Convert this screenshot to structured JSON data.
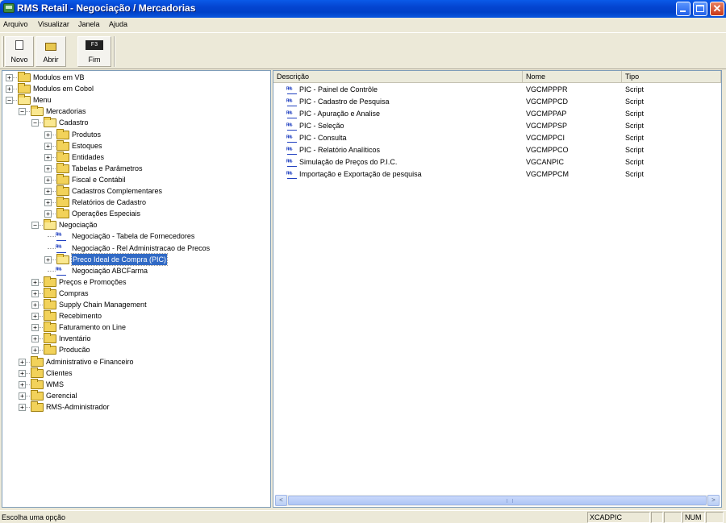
{
  "window": {
    "title": "RMS Retail - Negociação / Mercadorias",
    "minimize_icon": "minimize-icon",
    "maximize_icon": "maximize-icon",
    "close_symbol": "✕"
  },
  "menubar": {
    "items": [
      "Arquivo",
      "Visualizar",
      "Janela",
      "Ajuda"
    ]
  },
  "toolbar": {
    "new_label": "Novo",
    "open_label": "Abrir",
    "exit_label": "Fim",
    "exit_key": "F3"
  },
  "tree": {
    "nodes": [
      {
        "label": "Modulos em VB",
        "expander": "+"
      },
      {
        "label": "Modulos em Cobol",
        "expander": "+"
      },
      {
        "label": "Menu",
        "expander": "−"
      },
      {
        "label": "Mercadorias",
        "expander": "−"
      },
      {
        "label": "Cadastro",
        "expander": "−"
      },
      {
        "label": "Produtos",
        "expander": "+"
      },
      {
        "label": "Estoques",
        "expander": "+"
      },
      {
        "label": "Entidades",
        "expander": "+"
      },
      {
        "label": "Tabelas e Parâmetros",
        "expander": "+"
      },
      {
        "label": "Fiscal e Contábil",
        "expander": "+"
      },
      {
        "label": "Cadastros Complementares",
        "expander": "+"
      },
      {
        "label": "Relatórios de Cadastro",
        "expander": "+"
      },
      {
        "label": "Operações Especiais",
        "expander": "+"
      },
      {
        "label": "Negociação",
        "expander": "−"
      },
      {
        "label": "Negociação - Tabela de Fornecedores",
        "expander": ""
      },
      {
        "label": "Negociação - Rel Administracao de Precos",
        "expander": ""
      },
      {
        "label": "Preco Ideal de Compra (PIC)",
        "expander": "+"
      },
      {
        "label": "Negociação  ABCFarma",
        "expander": ""
      },
      {
        "label": "Preços e Promoções",
        "expander": "+"
      },
      {
        "label": "Compras",
        "expander": "+"
      },
      {
        "label": "Supply Chain Management",
        "expander": "+"
      },
      {
        "label": "Recebimento",
        "expander": "+"
      },
      {
        "label": "Faturamento on Line",
        "expander": "+"
      },
      {
        "label": "Inventário",
        "expander": "+"
      },
      {
        "label": "Producão",
        "expander": "+"
      },
      {
        "label": "Administrativo e Financeiro",
        "expander": "+"
      },
      {
        "label": "Clientes",
        "expander": "+"
      },
      {
        "label": "WMS",
        "expander": "+"
      },
      {
        "label": "Gerencial",
        "expander": "+"
      },
      {
        "label": "RMS-Administrador",
        "expander": "+"
      }
    ]
  },
  "list": {
    "columns": [
      "Descrição",
      "Nome",
      "Tipo"
    ],
    "rows": [
      {
        "desc": "PIC - Painel de Contrôle",
        "name": "VGCMPPPR",
        "type": "Script"
      },
      {
        "desc": "PIC - Cadastro de Pesquisa",
        "name": "VGCMPPCD",
        "type": "Script"
      },
      {
        "desc": "PIC - Apuração e Analise",
        "name": "VGCMPPAP",
        "type": "Script"
      },
      {
        "desc": "PIC - Seleção",
        "name": "VGCMPPSP",
        "type": "Script"
      },
      {
        "desc": "PIC - Consulta",
        "name": "VGCMPPCI",
        "type": "Script"
      },
      {
        "desc": "PIC - Relatório Analíticos",
        "name": "VGCMPPCO",
        "type": "Script"
      },
      {
        "desc": "Simulação de Preços do P.I.C.",
        "name": "VGCANPIC",
        "type": "Script"
      },
      {
        "desc": "Importação e Exportação de pesquisa",
        "name": "VGCMPPCM",
        "type": "Script"
      }
    ],
    "scroll_left": "<",
    "scroll_right": ">"
  },
  "statusbar": {
    "message": "Escolha uma opção",
    "program": "XCADPIC",
    "panel2": "",
    "panel3": "",
    "num": "NUM",
    "panel5": ""
  },
  "colors": {
    "titlebar": "#0a5ae8",
    "selection": "#316ac5",
    "folder": "#f2d25a"
  }
}
